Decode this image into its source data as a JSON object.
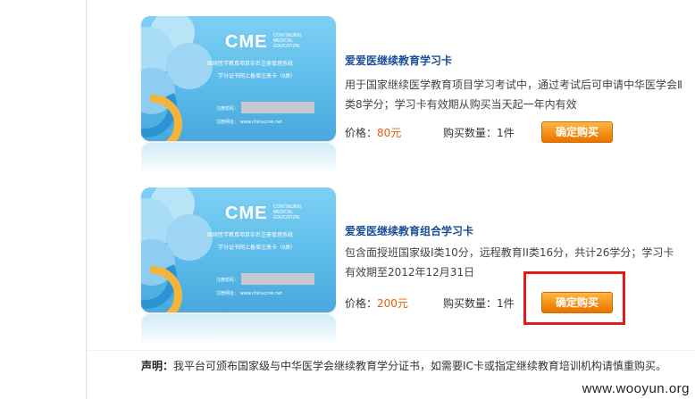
{
  "products": [
    {
      "card": {
        "brand": "CME",
        "brand_sub": "CONTINUING MEDICAL EDUCATION",
        "line1": "继续医学教育项目实名注册管理系统",
        "line2": "学分证书网上备案注册卡（Ⅱ类）",
        "field_label": "注册密码：",
        "site": "注册网址： www.chinacme.net"
      },
      "title": "爱爱医继续教育学习卡",
      "description": "用于国家继续医学教育项目学习考试中，通过考试后可申请中华医学会Ⅱ类8学分；学习卡有效期从购买当天起一年内有效",
      "price_label": "价格：",
      "price_value": "80元",
      "qty_label": "购买数量：1件",
      "buy_label": "确定购买"
    },
    {
      "card": {
        "brand": "CME",
        "brand_sub": "CONTINUING MEDICAL EDUCATION",
        "line1": "继续医学教育项目实名注册管理系统",
        "line2": "学分证书网上备案注册卡（Ⅱ类）",
        "field_label": "注册密码：",
        "site": "注册网址： www.chinacme.net"
      },
      "title": "爱爱医继续教育组合学习卡",
      "description": "包含面授班国家级I类10分，远程教育II类16分，共计26学分；学习卡有效期至2012年12月31日",
      "price_label": "价格：",
      "price_value": "200元",
      "qty_label": "购买数量：1件",
      "buy_label": "确定购买"
    }
  ],
  "notice": {
    "label": "声明：",
    "text": "我平台可颁布国家级与中华医学会继续教育学分证书，如需要IC卡或指定继续教育培训机构请慎重购买。"
  },
  "watermark": "www.wooyun.org",
  "colors": {
    "title": "#1a4e9a",
    "price": "#e35d0e",
    "button": "#f58c10",
    "highlight": "#e31b1b"
  }
}
